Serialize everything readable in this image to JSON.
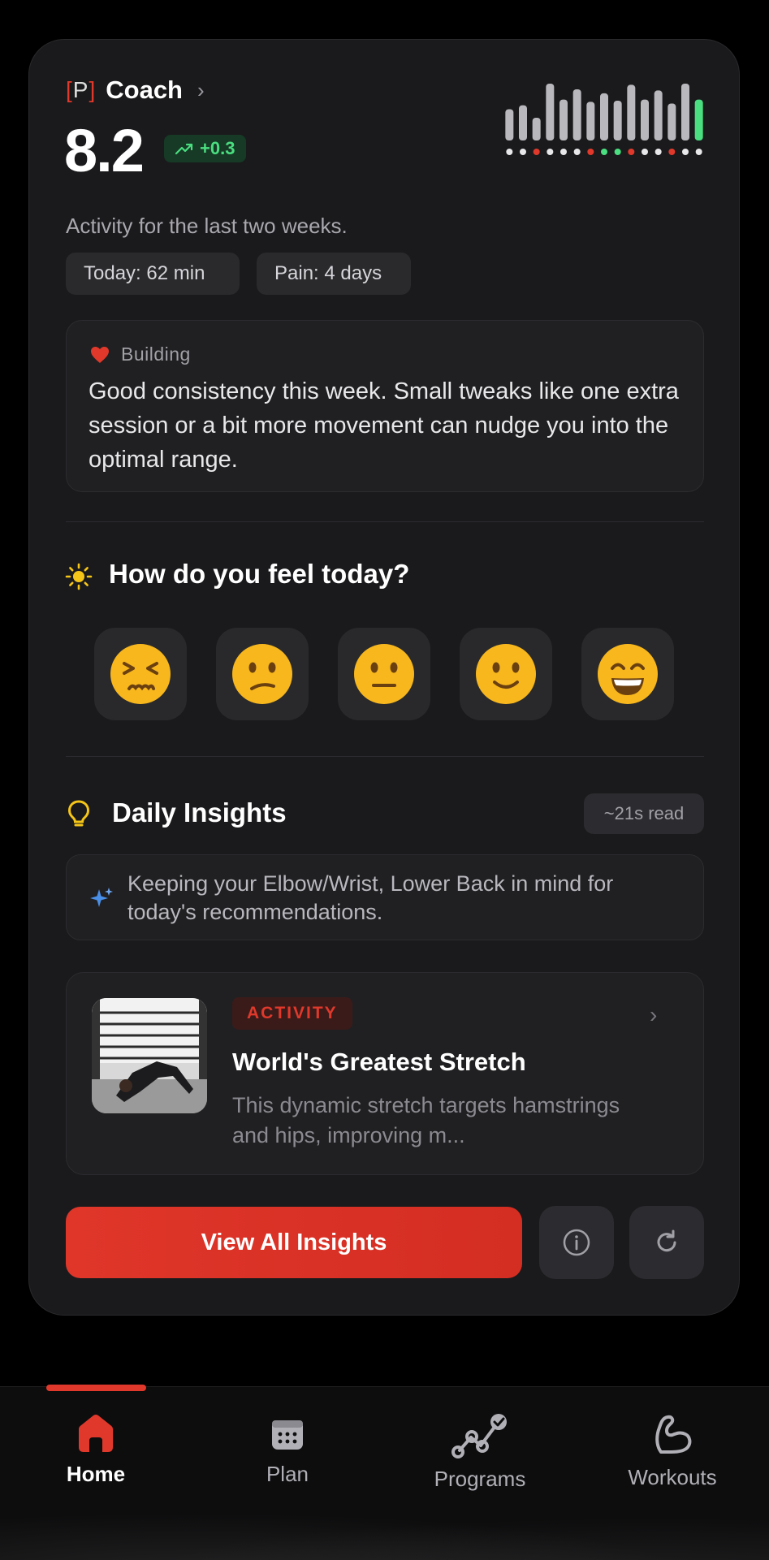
{
  "header": {
    "brand_prefix_open": "[",
    "brand_prefix_letter": "P",
    "brand_prefix_close": "]",
    "brand_name": "Coach",
    "score": "8.2",
    "delta": "+0.3"
  },
  "activity_chart": {
    "bar_levels": [
      0.55,
      0.62,
      0.4,
      1.0,
      0.72,
      0.9,
      0.68,
      0.83,
      0.7,
      0.98,
      0.72,
      0.88,
      0.65,
      1.0,
      0.72
    ],
    "dot_colors": [
      "#e8e8ea",
      "#e8e8ea",
      "#e0392b",
      "#e8e8ea",
      "#e8e8ea",
      "#e8e8ea",
      "#e0392b",
      "#4ade80",
      "#4ade80",
      "#e0392b",
      "#e8e8ea",
      "#e8e8ea",
      "#e0392b",
      "#e8e8ea",
      "#e8e8ea"
    ],
    "bar_color": "#b8b8bd",
    "highlight_color": "#4ade80"
  },
  "summary": {
    "subtitle": "Activity for the last two weeks.",
    "today": "Today: 62 min",
    "pain": "Pain: 4 days"
  },
  "status_card": {
    "label": "Building",
    "text": "Good consistency this week. Small tweaks like one extra session or a bit more movement can nudge you into the optimal range."
  },
  "mood": {
    "title": "How do you feel today?",
    "options": [
      "😣",
      "😕",
      "😐",
      "🙂",
      "😄"
    ]
  },
  "insights": {
    "title": "Daily Insights",
    "read_time": "~21s read",
    "memo": "Keeping your Elbow/Wrist, Lower Back in mind for today's recommendations.",
    "card": {
      "badge": "ACTIVITY",
      "title": "World's Greatest Stretch",
      "description": "This dynamic stretch targets hamstrings and hips, improving m..."
    },
    "cta": "View All Insights"
  },
  "nav": {
    "items": [
      {
        "label": "Home",
        "icon": "home-icon",
        "active": true
      },
      {
        "label": "Plan",
        "icon": "calendar-icon",
        "active": false
      },
      {
        "label": "Programs",
        "icon": "programs-icon",
        "active": false
      },
      {
        "label": "Workouts",
        "icon": "flexed-arm-icon",
        "active": false
      }
    ]
  }
}
